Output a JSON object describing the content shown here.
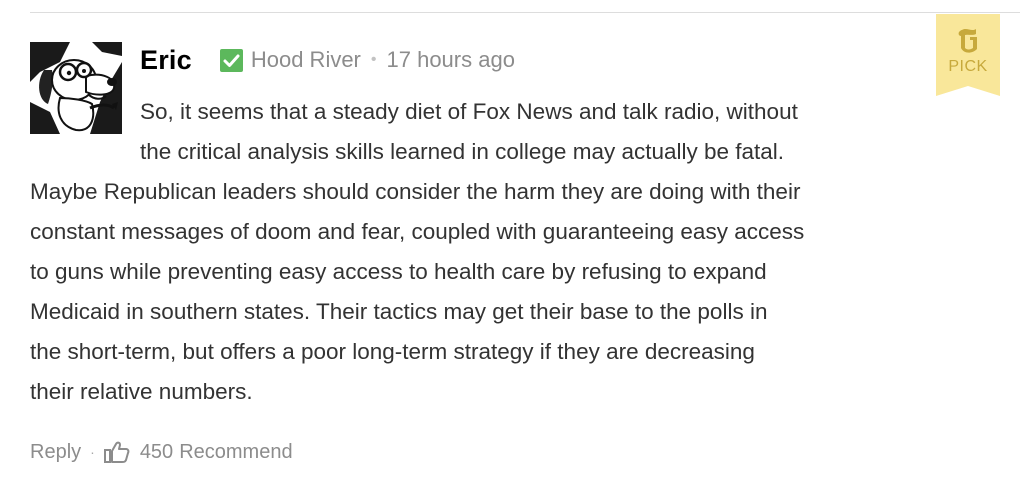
{
  "comment": {
    "author": "Eric",
    "verified": true,
    "location": "Hood River",
    "separator": "•",
    "timestamp": "17 hours ago",
    "pick_label": "PICK",
    "body_lines": [
      "So, it seems that a steady diet of Fox News and talk radio, without",
      "the critical analysis skills learned in college may actually be fatal.",
      "Maybe Republican leaders should consider the harm they are doing with their",
      "constant messages of doom and fear, coupled with guaranteeing easy access",
      "to guns while preventing easy access to health care by refusing to expand",
      "Medicaid in southern states. Their tactics may get their base to the polls in",
      "the short-term, but offers a poor long-term strategy if they are decreasing",
      "their relative numbers."
    ]
  },
  "actions": {
    "reply_label": "Reply",
    "separator": "·",
    "recommend_count": "450",
    "recommend_label": "Recommend"
  },
  "colors": {
    "verified_green": "#5cb85c",
    "pick_bg": "#f9e79a",
    "pick_text": "#c7a93c",
    "meta_gray": "#8c8c8c",
    "body_text": "#333333"
  },
  "icons": {
    "avatar": "cartoon-dog-with-glasses-avatar",
    "verified": "checkmark-square-icon",
    "pick": "nyt-t-logo-ribbon-icon",
    "recommend": "thumbs-up-icon"
  }
}
